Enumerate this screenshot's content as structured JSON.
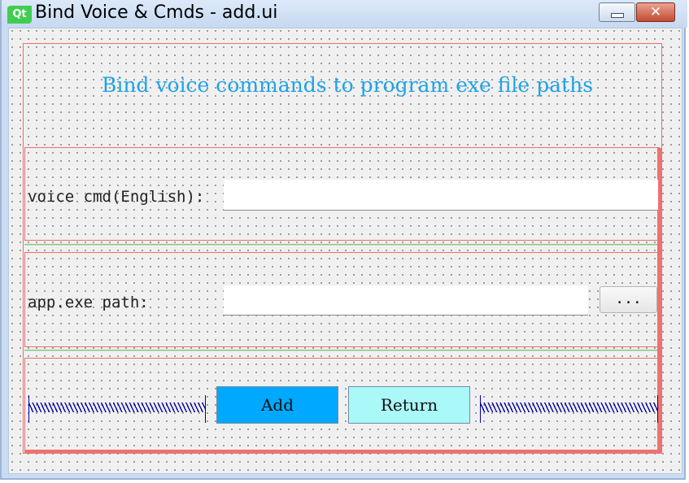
{
  "window": {
    "app_icon_text": "Qt",
    "title": "Bind Voice & Cmds - add.ui",
    "close_glyph": "✕"
  },
  "form": {
    "heading": "Bind voice commands to program exe file paths",
    "voice_cmd": {
      "label": "voice cmd(English):",
      "value": ""
    },
    "app_path": {
      "label": "app.exe path:",
      "value": ""
    },
    "browse_button": "...",
    "add_button": "Add",
    "return_button": "Return"
  },
  "colors": {
    "heading": "#1fa3e6",
    "add_button": "#00a8ff",
    "return_button": "#aaf8f8",
    "layout_border": "#f06c6c",
    "spacer": "#0000aa"
  }
}
